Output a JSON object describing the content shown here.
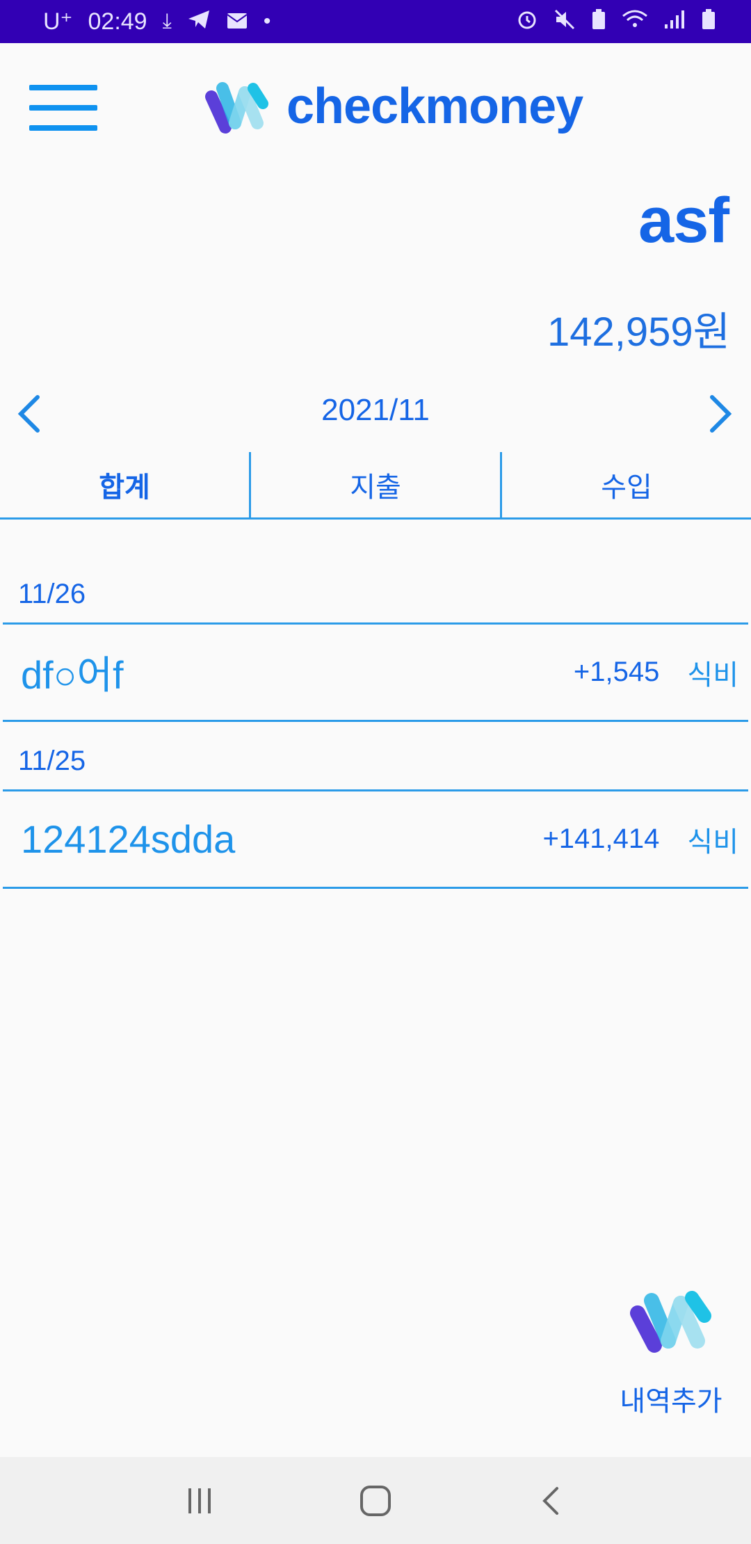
{
  "status_bar": {
    "carrier": "U⁺",
    "time": "02:49",
    "left_icons": [
      "download-icon",
      "telegram-icon",
      "mail-icon",
      "dot-icon"
    ],
    "right_icons": [
      "alarm-icon",
      "mute-icon",
      "battery-saver-icon",
      "wifi-icon",
      "signal-icon",
      "battery-icon"
    ]
  },
  "header": {
    "app_name": "checkmoney",
    "menu_icon": "hamburger-icon",
    "brand_colors": [
      "#5b3fd9",
      "#2bb5e6",
      "#7fd6ee"
    ]
  },
  "account": {
    "name": "asf",
    "balance": "142,959원"
  },
  "month_nav": {
    "label": "2021/11",
    "prev_icon": "chevron-left-icon",
    "next_icon": "chevron-right-icon"
  },
  "tabs": [
    {
      "label": "합계",
      "active": true
    },
    {
      "label": "지출",
      "active": false
    },
    {
      "label": "수입",
      "active": false
    }
  ],
  "groups": [
    {
      "date": "11/26",
      "entries": [
        {
          "title": "df○어f",
          "amount": "+1,545",
          "category": "식비"
        }
      ]
    },
    {
      "date": "11/25",
      "entries": [
        {
          "title": "124124sdda",
          "amount": "+141,414",
          "category": "식비"
        }
      ]
    }
  ],
  "add_button": {
    "label": "내역추가"
  },
  "nav_bar": {
    "icons": [
      "recent-apps-icon",
      "home-icon",
      "back-icon"
    ]
  },
  "colors": {
    "accent": "#1565e6",
    "line": "#2b9be8",
    "status_bar": "#3200b4"
  }
}
